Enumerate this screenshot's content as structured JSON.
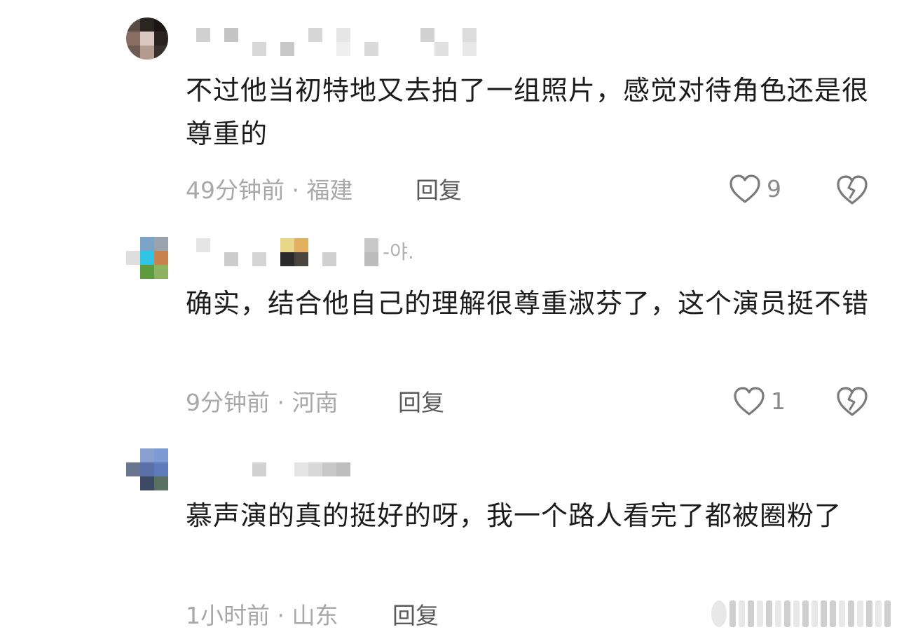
{
  "comments": [
    {
      "text": "不过他当初特地又去拍了一组照片，感觉对待角色还是很尊重的",
      "time": "49分钟前",
      "location": "福建",
      "reply_label": "回复",
      "likes": "9"
    },
    {
      "username_suffix": "-야.",
      "text": "确实，结合他自己的理解很尊重淑芬了，这个演员挺不错",
      "time": "9分钟前",
      "location": "河南",
      "reply_label": "回复",
      "likes": "1"
    },
    {
      "text": "慕声演的真的挺好的呀，我一个路人看完了都被圈粉了",
      "time": "1小时前",
      "location": "山东",
      "reply_label": "回复"
    }
  ],
  "meta_separator": " · ",
  "icons": {
    "like": "heart-outline-icon",
    "dislike": "broken-heart-icon"
  },
  "colors": {
    "text": "#1c1c1c",
    "meta": "#a8a8a8",
    "reply": "#5a5a5a",
    "icon": "#7a7a7a"
  }
}
